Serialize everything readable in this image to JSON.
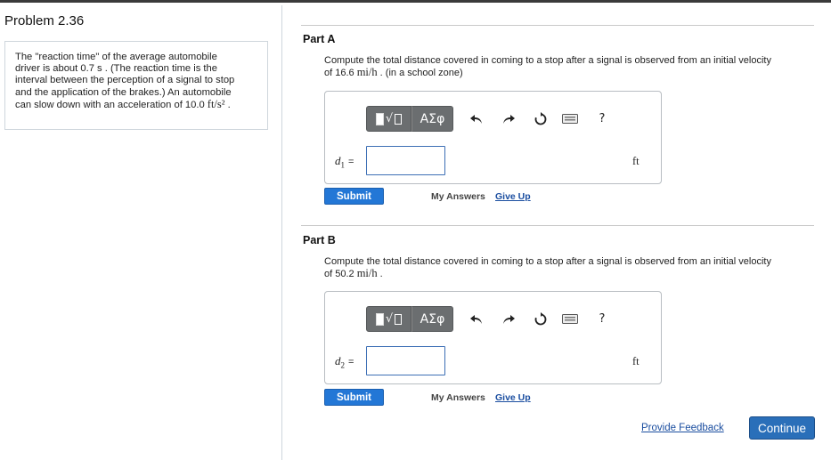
{
  "problem": {
    "title": "Problem 2.36",
    "text_line1": "The \"reaction time\" of the average automobile",
    "text_line2": "driver is about 0.7 s . (The reaction time is the",
    "text_line3": "interval between the perception of a signal to stop",
    "text_line4": "and the application of the brakes.) An automobile",
    "text_line5_pre": "can slow down with an acceleration of 10.0 ",
    "text_line5_unit": "ft/s²",
    "text_line5_post": " ."
  },
  "toolbar": {
    "greek_label": "ΑΣφ",
    "undo_icon": "undo-arrow-icon",
    "redo_icon": "redo-arrow-icon",
    "reset_icon": "reset-circle-icon",
    "keyboard_icon": "keyboard-icon",
    "help_label": "?"
  },
  "part_a": {
    "title": "Part A",
    "question_line1": "Compute the total distance covered in coming to a stop after a signal is observed from an initial velocity",
    "question_pre": "of 16.6 ",
    "question_unit": "mi/h",
    "question_post": " . (in a school zone)",
    "var_name": "d",
    "var_sub": "1",
    "var_eq": "=",
    "input_value": "",
    "unit": "ft",
    "submit_label": "Submit",
    "my_answers_label": "My Answers",
    "give_up_label": "Give Up"
  },
  "part_b": {
    "title": "Part B",
    "question_line1": "Compute the total distance covered in coming to a stop after a signal is observed from an initial velocity",
    "question_pre": "of 50.2 ",
    "question_unit": "mi/h",
    "question_post": " .",
    "var_name": "d",
    "var_sub": "2",
    "var_eq": "=",
    "input_value": "",
    "unit": "ft",
    "submit_label": "Submit",
    "my_answers_label": "My Answers",
    "give_up_label": "Give Up"
  },
  "footer": {
    "feedback_label": "Provide Feedback",
    "continue_label": "Continue"
  },
  "colors": {
    "accent_blue": "#2377d6",
    "link_blue": "#1b4ea0",
    "toolbar_gray": "#6b6e70"
  }
}
